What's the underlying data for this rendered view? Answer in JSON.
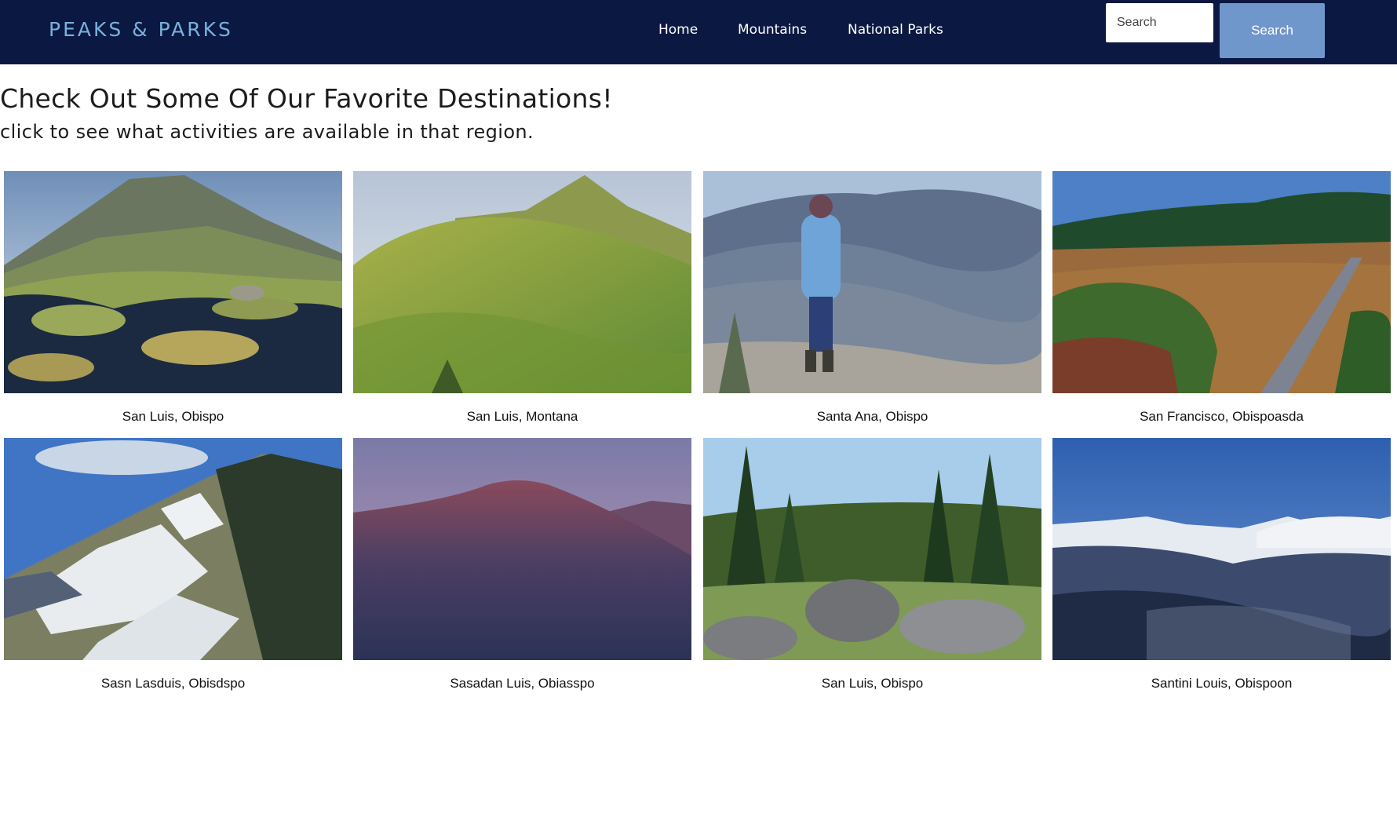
{
  "header": {
    "brand": "PEAKS & PARKS",
    "nav": [
      {
        "label": "Home"
      },
      {
        "label": "Mountains"
      },
      {
        "label": "National Parks"
      }
    ],
    "search": {
      "placeholder": "Search",
      "button_label": "Search"
    }
  },
  "main": {
    "title": "Check Out Some Of Our Favorite Destinations!",
    "subtitle": "click to see what activities are available in that region.",
    "destinations": [
      {
        "caption": "San Luis, Obispo"
      },
      {
        "caption": "San Luis, Montana"
      },
      {
        "caption": "Santa Ana, Obispo"
      },
      {
        "caption": "San Francisco, Obispoasda"
      },
      {
        "caption": "Sasn Lasduis, Obisdspo"
      },
      {
        "caption": "Sasadan Luis, Obiasspo"
      },
      {
        "caption": "San Luis, Obispo"
      },
      {
        "caption": "Santini Louis, Obispoon"
      }
    ]
  },
  "colors": {
    "nav_background": "#0b1841",
    "brand": "#78b2dc",
    "search_button": "#7097cc"
  }
}
